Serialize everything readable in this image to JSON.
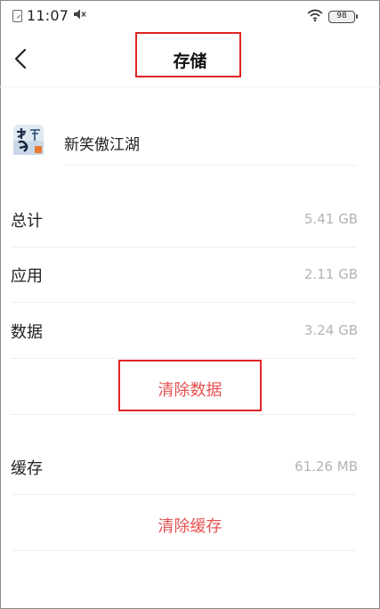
{
  "status_bar": {
    "time": "11:07",
    "battery": "98",
    "icons": [
      "sim-card-icon",
      "mute-icon",
      "wifi-icon",
      "battery-icon"
    ]
  },
  "header": {
    "title": "存储",
    "back_icon": "chevron-left-icon"
  },
  "app": {
    "name": "新笑傲江湖",
    "icon": "game-app-icon"
  },
  "storage": {
    "total": {
      "label": "总计",
      "value": "5.41 GB"
    },
    "app": {
      "label": "应用",
      "value": "2.11 GB"
    },
    "data": {
      "label": "数据",
      "value": "3.24 GB"
    },
    "clear_data_label": "清除数据",
    "cache": {
      "label": "缓存",
      "value": "61.26 MB"
    },
    "clear_cache_label": "清除缓存"
  },
  "colors": {
    "action_text": "#e8514f",
    "annotation_box": "#e02424",
    "value_text": "#b3b3b3"
  }
}
